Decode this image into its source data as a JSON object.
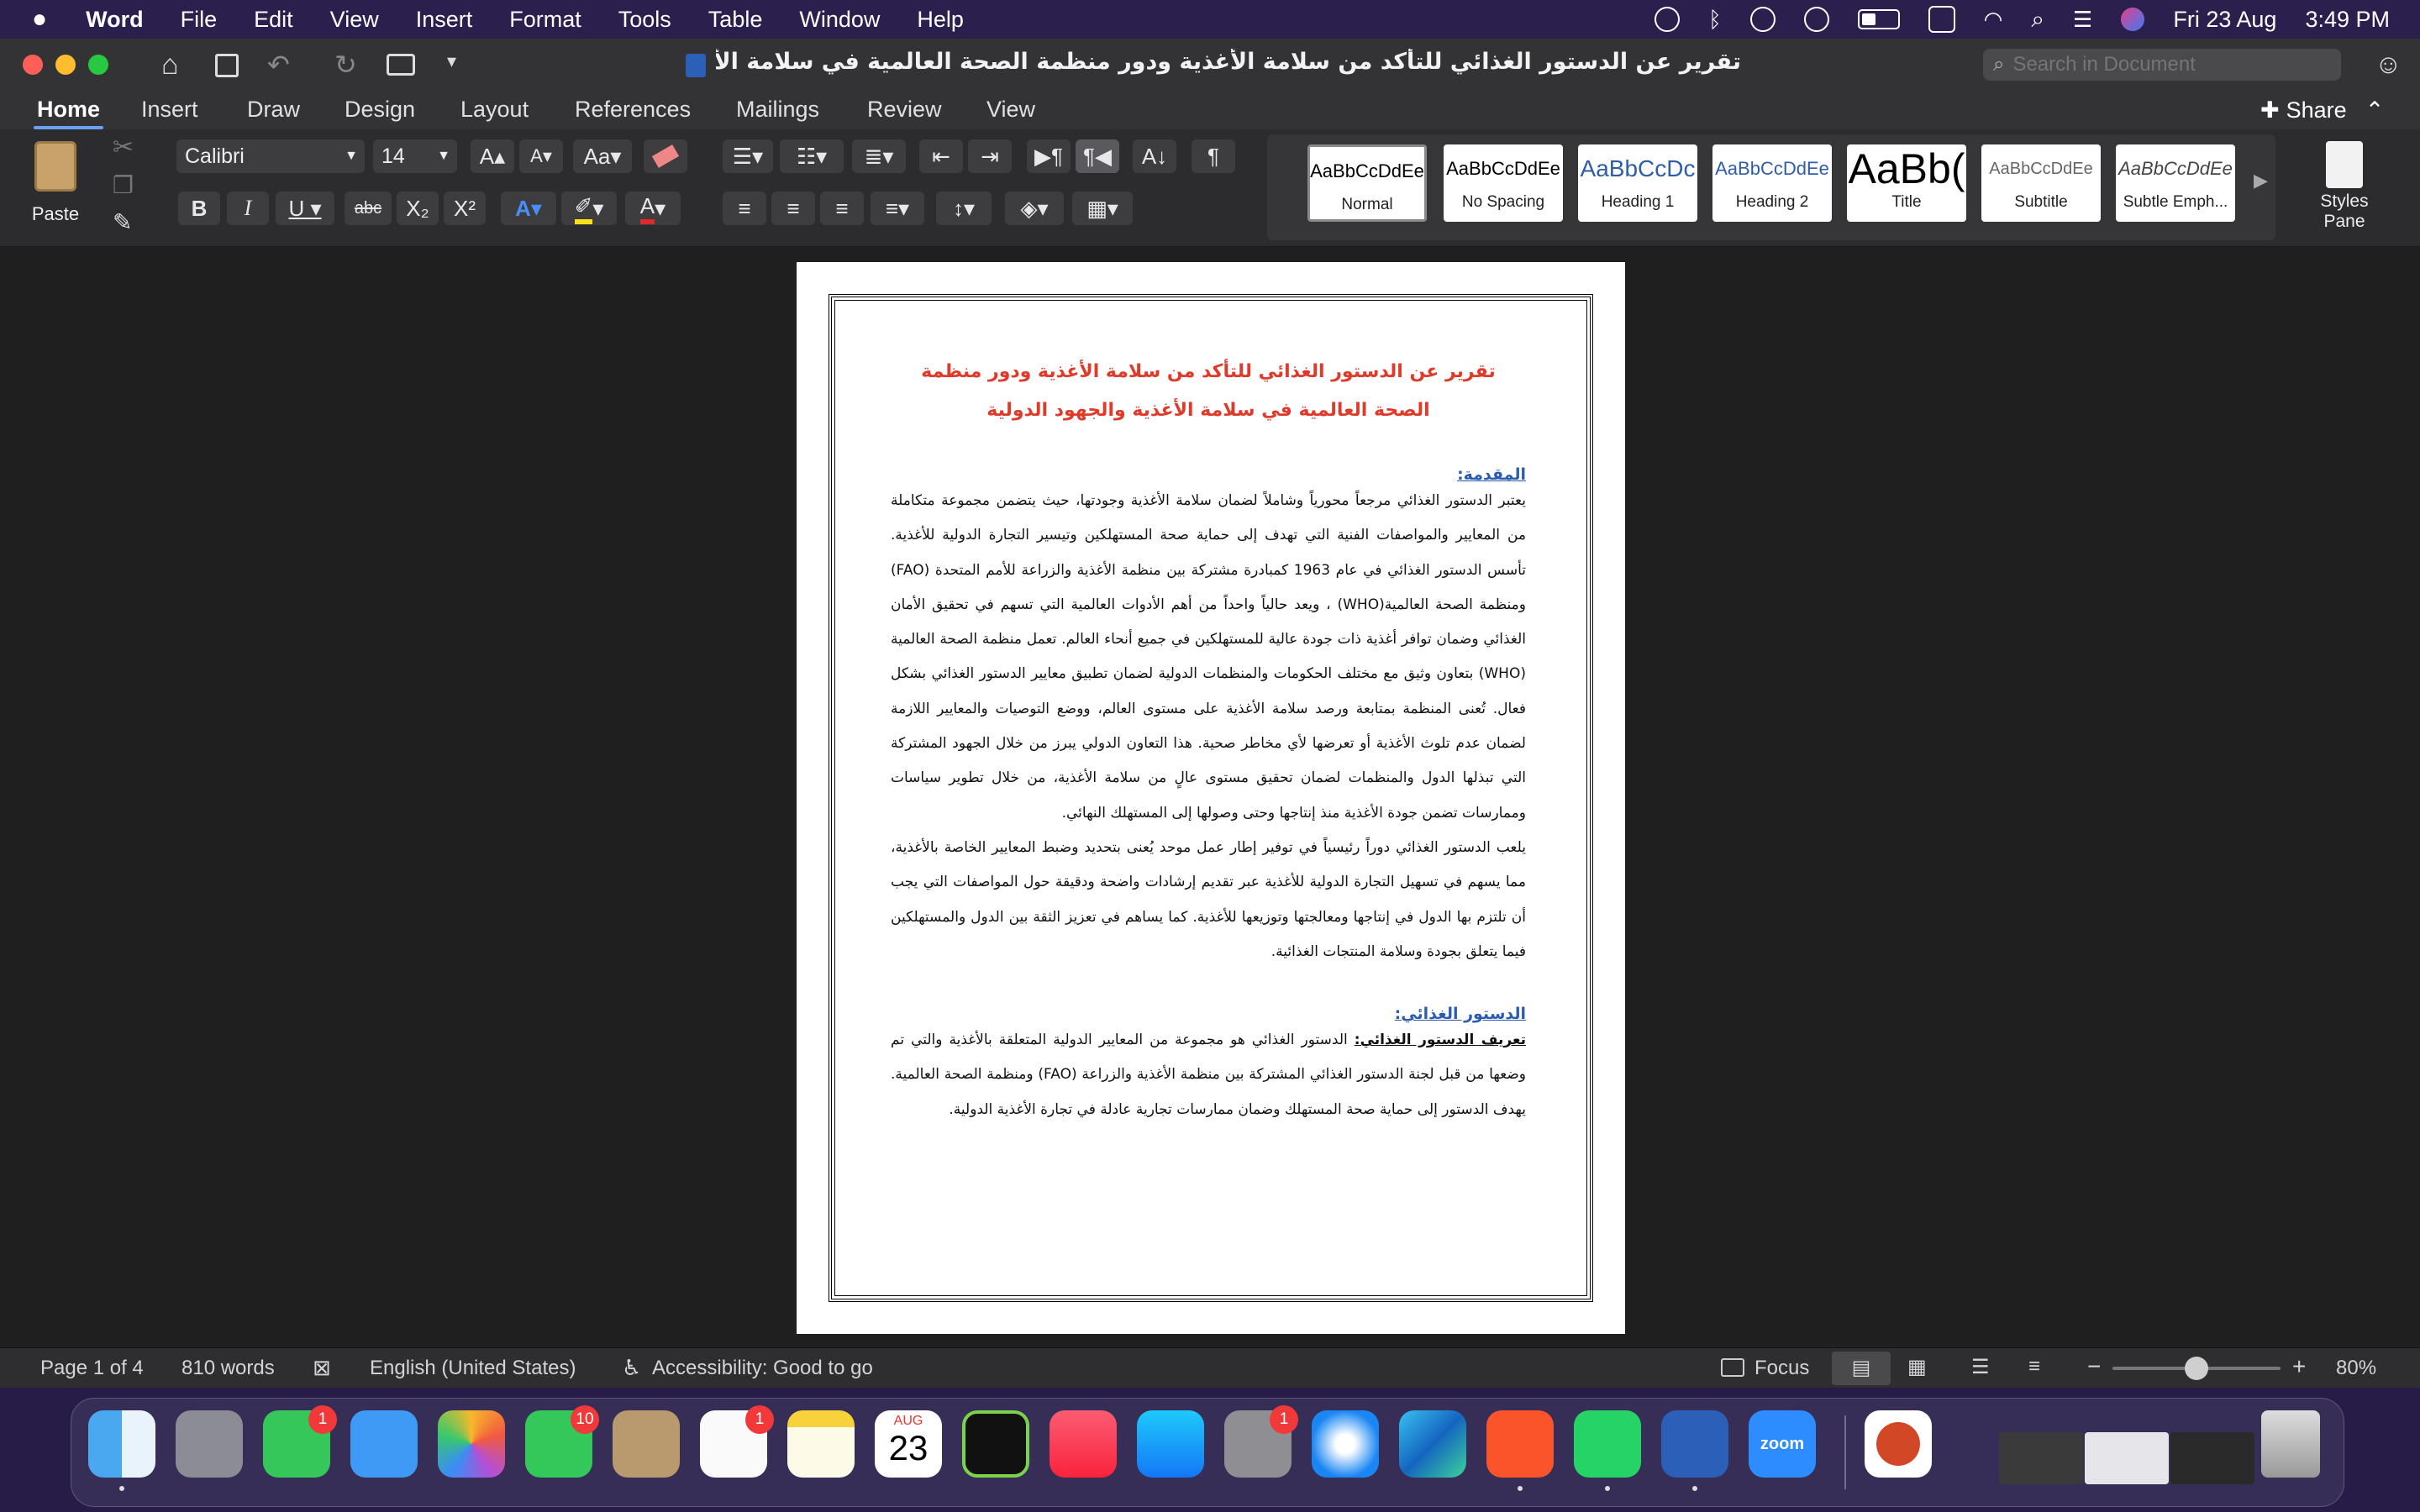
{
  "menubar": {
    "app": "Word",
    "items": [
      "File",
      "Edit",
      "View",
      "Insert",
      "Format",
      "Tools",
      "Table",
      "Window",
      "Help"
    ],
    "date": "Fri 23 Aug",
    "time": "3:49 PM"
  },
  "window": {
    "title": "تقرير عن الدستور الغذائي للتأكد من سلامة الأغذية ودور منظمة الصحة العالمية في سلامة الأغذية والجهود الدولية",
    "search_placeholder": "Search in Document"
  },
  "tabs": [
    "Home",
    "Insert",
    "Draw",
    "Design",
    "Layout",
    "References",
    "Mailings",
    "Review",
    "View"
  ],
  "share_label": "Share",
  "ribbon": {
    "paste": "Paste",
    "font": "Calibri",
    "size": "14",
    "styles_pane": "Styles Pane",
    "styles": [
      {
        "preview": "AaBbCcDdEe",
        "name": "Normal"
      },
      {
        "preview": "AaBbCcDdEe",
        "name": "No Spacing"
      },
      {
        "preview": "AaBbCcDc",
        "name": "Heading 1"
      },
      {
        "preview": "AaBbCcDdEe",
        "name": "Heading 2"
      },
      {
        "preview": "AaBb(",
        "name": "Title"
      },
      {
        "preview": "AaBbCcDdEe",
        "name": "Subtitle"
      },
      {
        "preview": "AaBbCcDdEe",
        "name": "Subtle Emph..."
      }
    ]
  },
  "document": {
    "title_line1": "تقرير عن الدستور الغذائي للتأكد من سلامة الأغذية ودور منظمة",
    "title_line2": "الصحة العالمية في سلامة الأغذية والجهود الدولية",
    "heading_intro": "المقدمة:",
    "intro_p1": "يعتبر الدستور الغذائي مرجعاً محورياً وشاملاً لضمان سلامة الأغذية وجودتها، حيث يتضمن مجموعة متكاملة من المعايير والمواصفات الفنية التي تهدف إلى حماية صحة المستهلكين وتيسير التجارة الدولية للأغذية. تأسس الدستور الغذائي في عام 1963 كمبادرة مشتركة بين منظمة الأغذية والزراعة للأمم المتحدة (FAO) ومنظمة الصحة العالمية(WHO) ، ويعد حالياً واحداً من أهم الأدوات العالمية التي تسهم في تحقيق الأمان الغذائي وضمان توافر أغذية ذات جودة عالية للمستهلكين في جميع أنحاء العالم. تعمل منظمة الصحة العالمية (WHO) بتعاون وثيق مع مختلف الحكومات والمنظمات الدولية لضمان تطبيق معايير الدستور الغذائي بشكل فعال. تُعنى المنظمة بمتابعة ورصد سلامة الأغذية على مستوى العالم، ووضع التوصيات والمعايير اللازمة لضمان عدم تلوث الأغذية أو تعرضها لأي مخاطر صحية. هذا التعاون الدولي يبرز من خلال الجهود المشتركة التي تبذلها الدول والمنظمات لضمان تحقيق مستوى عالٍ من سلامة الأغذية، من خلال تطوير سياسات وممارسات تضمن جودة الأغذية منذ إنتاجها وحتى وصولها إلى المستهلك النهائي.",
    "intro_p2": "يلعب الدستور الغذائي دوراً رئيسياً في توفير إطار عمل موحد يُعنى بتحديد وضبط المعايير الخاصة بالأغذية، مما يسهم في تسهيل التجارة الدولية للأغذية عبر تقديم إرشادات واضحة ودقيقة حول المواصفات التي يجب أن تلتزم بها الدول في إنتاجها ومعالجتها وتوزيعها للأغذية. كما يساهم في تعزيز الثقة بين الدول والمستهلكين فيما يتعلق بجودة وسلامة المنتجات الغذائية.",
    "heading_codex": "الدستور الغذائي:",
    "def_label": "تعريف الدستور الغذائي:",
    "def_text": " الدستور الغذائي هو مجموعة من المعايير الدولية المتعلقة بالأغذية والتي تم وضعها من قبل لجنة الدستور الغذائي المشتركة بين منظمة الأغذية والزراعة (FAO) ومنظمة الصحة العالمية. يهدف الدستور إلى حماية صحة المستهلك وضمان ممارسات تجارية عادلة في تجارة الأغذية الدولية."
  },
  "status": {
    "page": "Page 1 of 4",
    "words": "810 words",
    "language": "English (United States)",
    "accessibility": "Accessibility: Good to go",
    "focus": "Focus",
    "zoom": "80%",
    "zoom_fraction": 0.5
  },
  "dock": {
    "badges": {
      "messages": "1",
      "facetime": "10",
      "reminders": "1",
      "settings": "1"
    },
    "calendar_month": "AUG",
    "calendar_day": "23",
    "zoom_label": "zoom"
  }
}
